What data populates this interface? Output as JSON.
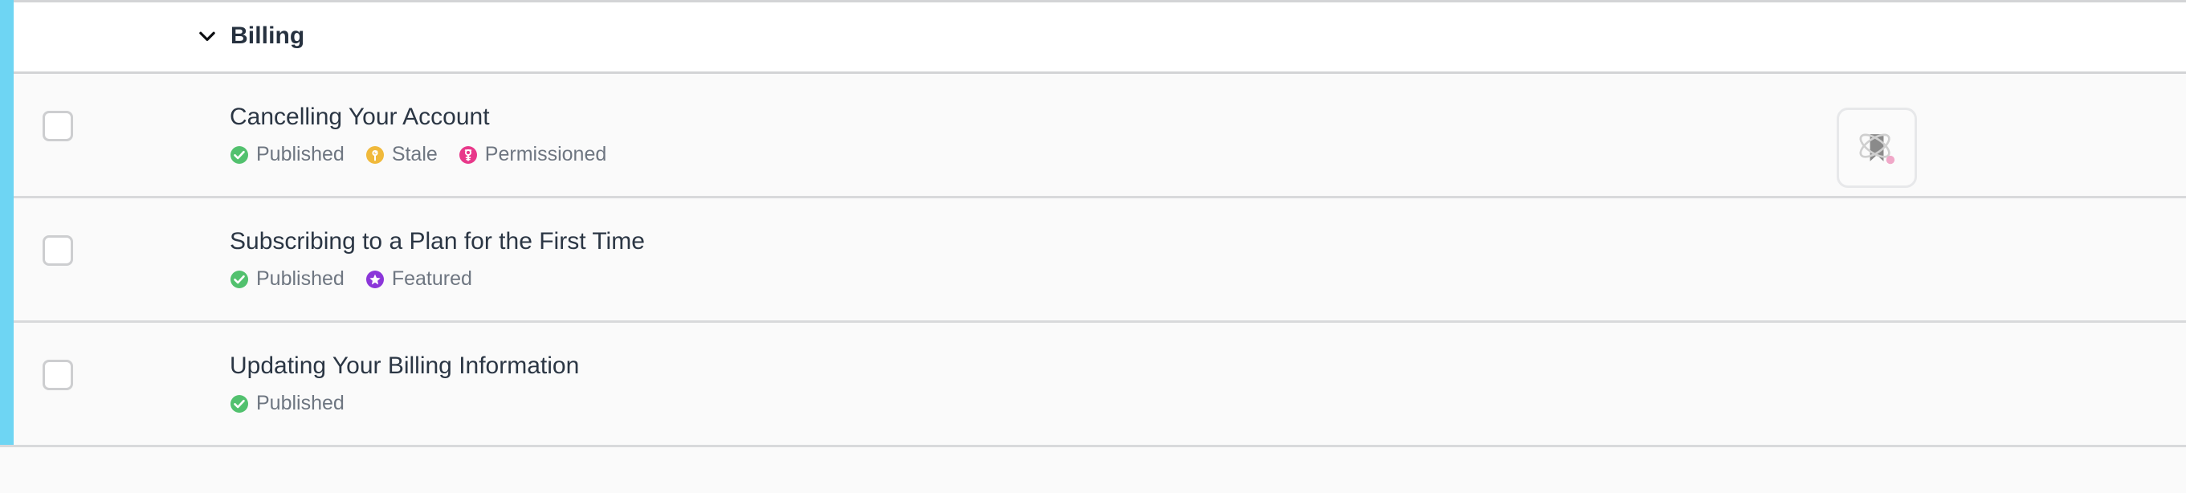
{
  "colors": {
    "accent_stripe": "#6ed5f3",
    "row_background": "#fafafa",
    "header_background": "#ffffff",
    "divider": "#d3d4d6",
    "title_text": "#2b3644",
    "badge_text": "#6e7681",
    "published_green": "#52c16e",
    "stale_amber": "#f0b93b",
    "permissioned_pink": "#e8388a",
    "featured_purple": "#8b36d9",
    "icon_gray": "#8a8a8a",
    "notification_pink": "#f0a8c8"
  },
  "section": {
    "title": "Billing",
    "expanded": true,
    "chevron_icon": "chevron-down-icon"
  },
  "badge_types": {
    "published": {
      "label": "Published",
      "icon": "check-circle-icon",
      "color": "#52c16e"
    },
    "stale": {
      "label": "Stale",
      "icon": "clock-circle-icon",
      "color": "#f0b93b"
    },
    "permissioned": {
      "label": "Permissioned",
      "icon": "key-circle-icon",
      "color": "#e8388a"
    },
    "featured": {
      "label": "Featured",
      "icon": "star-circle-icon",
      "color": "#8b36d9"
    }
  },
  "rows": [
    {
      "title": "Cancelling Your Account",
      "checkbox_checked": false,
      "badges": [
        {
          "label": "Published",
          "icon": "check-circle-icon",
          "color": "#52c16e"
        },
        {
          "label": "Stale",
          "icon": "clock-circle-icon",
          "color": "#f0b93b"
        },
        {
          "label": "Permissioned",
          "icon": "key-circle-icon",
          "color": "#e8388a"
        }
      ],
      "action": {
        "icon": "bookmark-orbit-icon",
        "has_notification_dot": true,
        "notification_dot_color": "#f0a8c8"
      }
    },
    {
      "title": "Subscribing to a Plan for the First Time",
      "checkbox_checked": false,
      "badges": [
        {
          "label": "Published",
          "icon": "check-circle-icon",
          "color": "#52c16e"
        },
        {
          "label": "Featured",
          "icon": "star-circle-icon",
          "color": "#8b36d9"
        }
      ],
      "action": null
    },
    {
      "title": "Updating Your Billing Information",
      "checkbox_checked": false,
      "badges": [
        {
          "label": "Published",
          "icon": "check-circle-icon",
          "color": "#52c16e"
        }
      ],
      "action": null
    }
  ]
}
